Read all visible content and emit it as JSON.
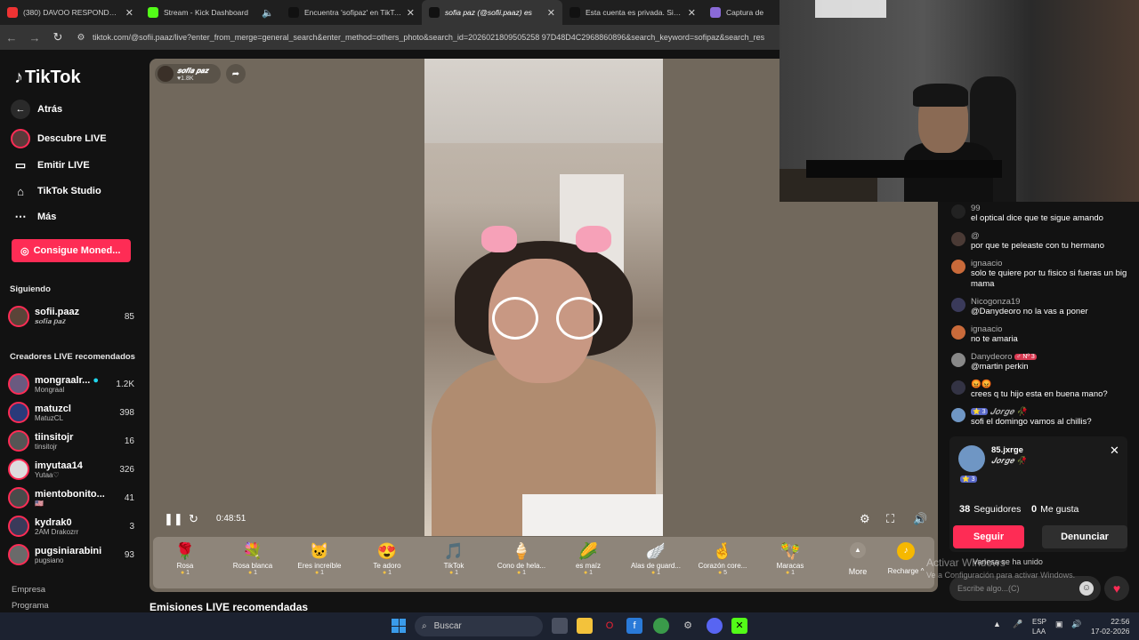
{
  "browser": {
    "tabs": [
      {
        "title": "(380) DAVOO RESPONDE - CON",
        "favicon_color": "#e33"
      },
      {
        "title": "Stream - Kick Dashboard",
        "favicon_color": "#53fc18"
      },
      {
        "title": "Encuentra 'sofipaz' en TikTok |",
        "favicon_color": "#111"
      },
      {
        "title": "sofia paz (@sofii.paaz) es",
        "favicon_color": "#111"
      },
      {
        "title": "Esta cuenta es privada. Sigue e",
        "favicon_color": "#111"
      },
      {
        "title": "Captura de",
        "favicon_color": "#8a6ad8"
      }
    ],
    "close_glyph": "✕",
    "url": "tiktok.com/@sofii.paaz/live?enter_from_merge=general_search&enter_method=others_photo&search_id=2026021809505258 97D48D4C2968860896&search_keyword=sofipaz&search_res"
  },
  "sidebar": {
    "logo": "TikTok",
    "back": "Atrás",
    "nav": [
      {
        "label": "Descubre LIVE",
        "icon": "live-avatar-icon"
      },
      {
        "label": "Emitir LIVE",
        "icon": "camera-icon"
      },
      {
        "label": "TikTok Studio",
        "icon": "home-icon"
      },
      {
        "label": "Más",
        "icon": "more-dots-icon"
      }
    ],
    "coins_button": "Consigue Moned...",
    "following_title": "Siguiendo",
    "following": [
      {
        "name": "sofii.paaz",
        "sub": "𝒔𝒐𝒇𝒊𝒂 𝒑𝒂𝒛",
        "count": "85"
      }
    ],
    "recommended_title": "Creadores LIVE recomendados",
    "recommended": [
      {
        "name": "mongraalr...",
        "sub": "Mongraal",
        "count": "1.2K"
      },
      {
        "name": "matuzcl",
        "sub": "MatuzCL",
        "count": "398"
      },
      {
        "name": "tiinsitojr",
        "sub": "tinsitojr",
        "count": "16"
      },
      {
        "name": "imyutaa14",
        "sub": "Yutaa♡",
        "count": "326"
      },
      {
        "name": "mientobonito...",
        "sub": "🇺🇸",
        "count": "41"
      },
      {
        "name": "kydrak0",
        "sub": "2AM Drakozrr",
        "count": "3"
      },
      {
        "name": "pugsiniarabini",
        "sub": "pugsiano",
        "count": "93"
      }
    ],
    "footer": [
      "Empresa",
      "Programa"
    ]
  },
  "player": {
    "streamer_name": "𝒔𝒐𝒇𝒊𝒂 𝒑𝒂𝒛",
    "streamer_likes": "♥1.8K",
    "elapsed": "0:48:51",
    "gifts": [
      {
        "name": "Rosa",
        "price": "1",
        "icon": "🌹"
      },
      {
        "name": "Rosa blanca",
        "price": "1",
        "icon": "💐"
      },
      {
        "name": "Eres increíble",
        "price": "1",
        "icon": "🐱"
      },
      {
        "name": "Te adoro",
        "price": "1",
        "icon": "😍"
      },
      {
        "name": "TikTok",
        "price": "1",
        "icon": "🎵"
      },
      {
        "name": "Cono de hela...",
        "price": "1",
        "icon": "🍦"
      },
      {
        "name": "es maíz",
        "price": "1",
        "icon": "🌽"
      },
      {
        "name": "Alas de guard...",
        "price": "1",
        "icon": "🪽"
      },
      {
        "name": "Corazón core...",
        "price": "5",
        "icon": "🤞"
      },
      {
        "name": "Maracas",
        "price": "1",
        "icon": "🪇"
      }
    ],
    "more_label": "More",
    "recharge_label": "Recharge ^"
  },
  "section_title": "Emisiones LIVE recomendadas",
  "chat": {
    "messages": [
      {
        "user": "99",
        "text": "el optical dice que te sigue amando",
        "color": "#222"
      },
      {
        "user": "@",
        "text": "por que te peleaste con tu hermano",
        "color": "#4a3a35"
      },
      {
        "user": "ignaacio",
        "text": "solo te quiere por tu fisico si fueras un big mama",
        "color": "#c96a3a"
      },
      {
        "user": "Nicogonza19",
        "text": "@Danydeoro no la vas a poner",
        "color": "#3a3a5a"
      },
      {
        "user": "ignaacio",
        "text": "no te amaria",
        "color": "#c96a3a"
      },
      {
        "user": "Danydeoro",
        "badge": "♂ Nº 3",
        "text": "@martin perkin",
        "color": "#888"
      },
      {
        "user": "😡😡",
        "text": "crees q tu hijo esta en buena mano?",
        "color": "#334"
      },
      {
        "user": "𝑱𝒐𝒓𝒈𝒆 🥀",
        "badge": "⭐ 3",
        "text": "sofi el domingo vamos al chillis?",
        "color": "#6f96c4"
      }
    ],
    "profile_card": {
      "handle": "85.jxrge",
      "display": "𝑱𝒐𝒓𝒈𝒆 🥀",
      "level": "⭐ 3",
      "followers": "38",
      "followers_label": "Seguidores",
      "likes": "0",
      "likes_label": "Me gusta",
      "follow_button": "Seguir",
      "report_button": "Denunciar"
    },
    "joined_text": "Vanesa se ha unido",
    "input_placeholder": "Escribe algo...(C)"
  },
  "watermark": {
    "line1": "Activar Windows",
    "line2": "Ve a Configuración para activar Windows."
  },
  "taskbar": {
    "search": "Buscar",
    "lang": "ESP",
    "lang2": "LAA",
    "time": "22:56",
    "date": "17-02-2026"
  }
}
